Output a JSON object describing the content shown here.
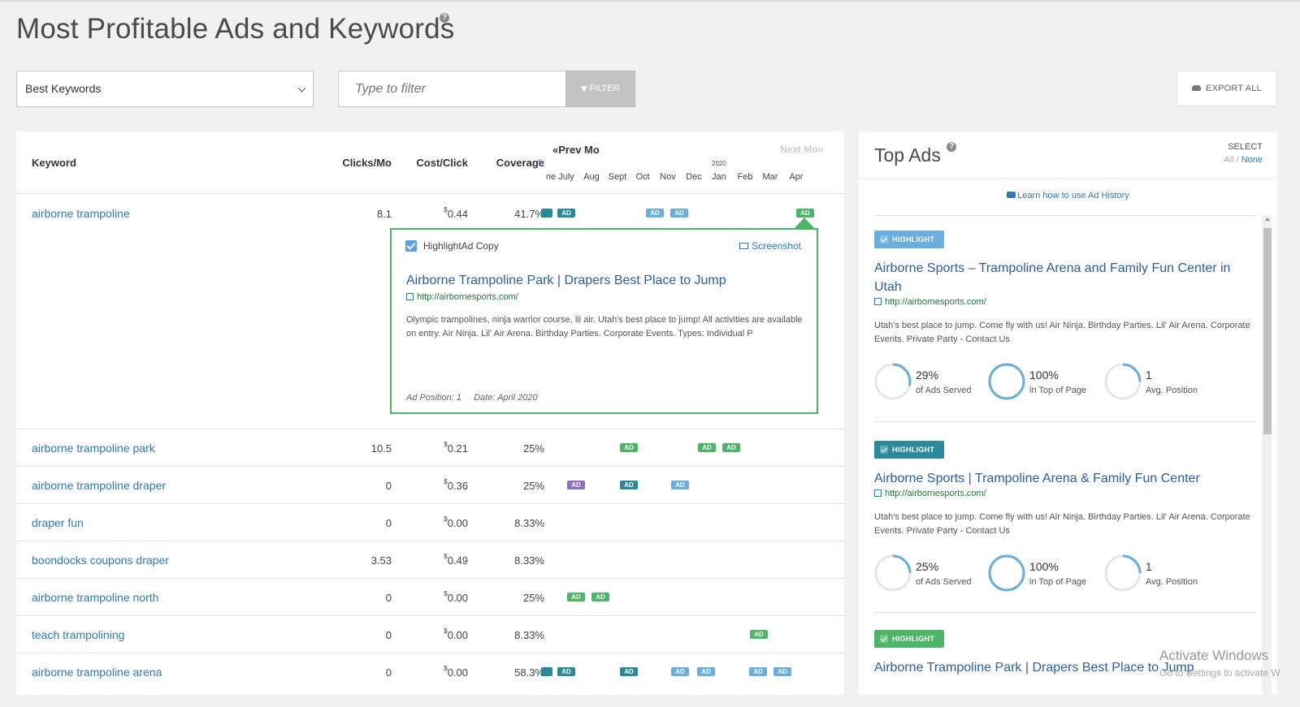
{
  "page": {
    "title": "Most Profitable Ads and Keywords"
  },
  "controls": {
    "select_value": "Best Keywords",
    "filter_placeholder": "Type to filter",
    "filter_label": "FILTER",
    "export_label": "EXPORT ALL"
  },
  "table": {
    "headers": {
      "keyword": "Keyword",
      "clicks": "Clicks/Mo",
      "cost": "Cost/Click",
      "coverage": "Coverage"
    },
    "prev_label": "«Prev Mo",
    "next_label": "Next Mo»",
    "year_label": "2020",
    "months": [
      "ne",
      "July",
      "Aug",
      "Sept",
      "Oct",
      "Nov",
      "Dec",
      "Jan",
      "Feb",
      "Mar",
      "Apr"
    ],
    "badge_label": "AD",
    "currency_symbol": "$",
    "rows": [
      {
        "keyword": "airborne trampoline",
        "clicks": "8.1",
        "cost": "0.44",
        "coverage": "41.7%"
      },
      {
        "keyword": "airborne trampoline park",
        "clicks": "10.5",
        "cost": "0.21",
        "coverage": "25%"
      },
      {
        "keyword": "airborne trampoline draper",
        "clicks": "0",
        "cost": "0.36",
        "coverage": "25%"
      },
      {
        "keyword": "draper fun",
        "clicks": "0",
        "cost": "0.00",
        "coverage": "8.33%"
      },
      {
        "keyword": "boondocks coupons draper",
        "clicks": "3.53",
        "cost": "0.49",
        "coverage": "8.33%"
      },
      {
        "keyword": "airborne trampoline north",
        "clicks": "0",
        "cost": "0.00",
        "coverage": "25%"
      },
      {
        "keyword": "teach trampolining",
        "clicks": "0",
        "cost": "0.00",
        "coverage": "8.33%"
      },
      {
        "keyword": "airborne trampoline arena",
        "clicks": "0",
        "cost": "0.00",
        "coverage": "58.3%"
      }
    ]
  },
  "popover": {
    "highlight_label": "HighlightAd Copy",
    "screenshot_label": "Screenshot",
    "title": "Airborne Trampoline Park | Drapers Best Place to Jump",
    "url": "http://airbornesports.com/",
    "description": "Olympic trampolines, ninja warrior course, lil air. Utah's best place to jump! All activities are available on entry. Air Ninja. Lil' Air Arena. Birthday Parties. Corporate Events. Types: Individual P",
    "position": "Ad Position: 1",
    "date": "Date: April 2020"
  },
  "top_ads": {
    "title": "Top Ads",
    "select_label": "SELECT",
    "select_all": "All",
    "select_sep": " / ",
    "select_none": "None",
    "learn_link": "Learn how to use Ad History",
    "highlight_label": "HIGHLIGHT",
    "ads": [
      {
        "title": "Airborne Sports – Trampoline Arena and Family Fun Center in Utah",
        "url": "http://airbornesports.com/",
        "description": "Utah's best place to jump. Come fly with us! Air Ninja. Birthday Parties. Lil' Air Arena. Corporate Events. Private Party - Contact Us",
        "served": "29%",
        "served_label": "of Ads Served",
        "top": "100%",
        "top_label": "in Top of Page",
        "position": "1",
        "position_label": "Avg. Position"
      },
      {
        "title": "Airborne Sports | Trampoline Arena & Family Fun Center",
        "url": "http://airbornesports.com/",
        "description": "Utah's best place to jump. Come fly with us! Air Ninja. Birthday Parties. Lil' Air Arena. Corporate Events. Private Party - Contact Us",
        "served": "25%",
        "served_label": "of Ads Served",
        "top": "100%",
        "top_label": "in Top of Page",
        "position": "1",
        "position_label": "Avg. Position"
      },
      {
        "title": "Airborne Trampoline Park | Drapers Best Place to Jump"
      }
    ]
  },
  "watermark": {
    "line1": "Activate Windows",
    "line2": "Go to Settings to activate W"
  },
  "colors": {
    "accent": "#2e7ab7",
    "highlight_green": "#4cb567",
    "badge_teal": "#2a8a9c",
    "badge_blue": "#6aaee0",
    "badge_purple": "#8e6fbe"
  }
}
